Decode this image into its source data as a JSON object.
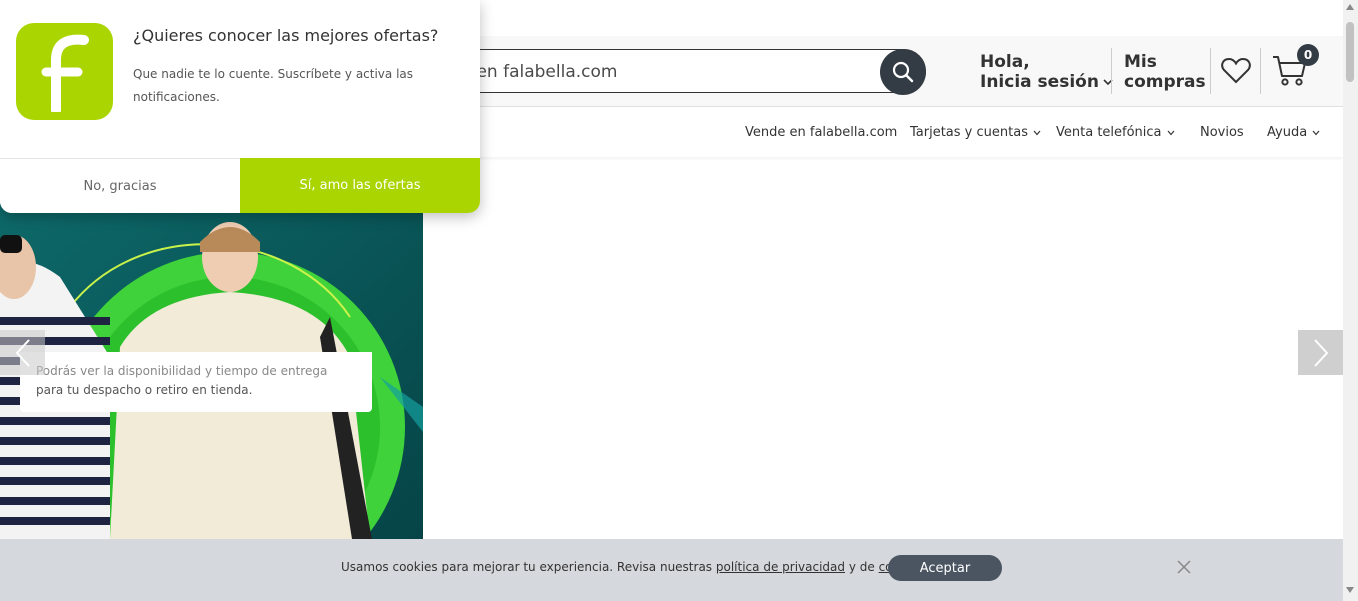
{
  "header": {
    "search_placeholder": "Buscar en falabella.com",
    "login_greeting": "Hola,",
    "login_action": "Inicia sesión",
    "purchases_line1": "Mis",
    "purchases_line2": "compras",
    "cart_count": "0",
    "icons": {
      "search": "search-icon",
      "wishlist": "heart-icon",
      "cart": "cart-icon"
    }
  },
  "nav": {
    "items": [
      {
        "label": "Vende en falabella.com",
        "has_dropdown": false
      },
      {
        "label": "Tarjetas y cuentas",
        "has_dropdown": true
      },
      {
        "label": "Venta telefónica",
        "has_dropdown": true
      },
      {
        "label": "Novios",
        "has_dropdown": false
      },
      {
        "label": "Ayuda",
        "has_dropdown": true
      }
    ]
  },
  "banner": {
    "tip_line1": "Podrás ver la disponibilidad y tiempo de entrega",
    "tip_line2": "para tu despacho o retiro en tienda."
  },
  "popup": {
    "title": "¿Quieres conocer las mejores ofertas?",
    "text": "Que nadie te lo cuente. Suscríbete y activa las notificaciones.",
    "decline_label": "No, gracias",
    "accept_label": "Sí, amo las ofertas",
    "logo_icon": "falabella-logo-icon"
  },
  "cookies": {
    "text_before": "Usamos cookies para mejorar tu experiencia. Revisa nuestras",
    "privacy_link": "política de privacidad",
    "text_middle": "y de",
    "cookies_link": "cookies",
    "text_after": ".",
    "accept_label": "Aceptar"
  },
  "colors": {
    "brand_green": "#aad500",
    "dark_slate": "#333c45",
    "cookie_bar": "#d5d8dc"
  }
}
